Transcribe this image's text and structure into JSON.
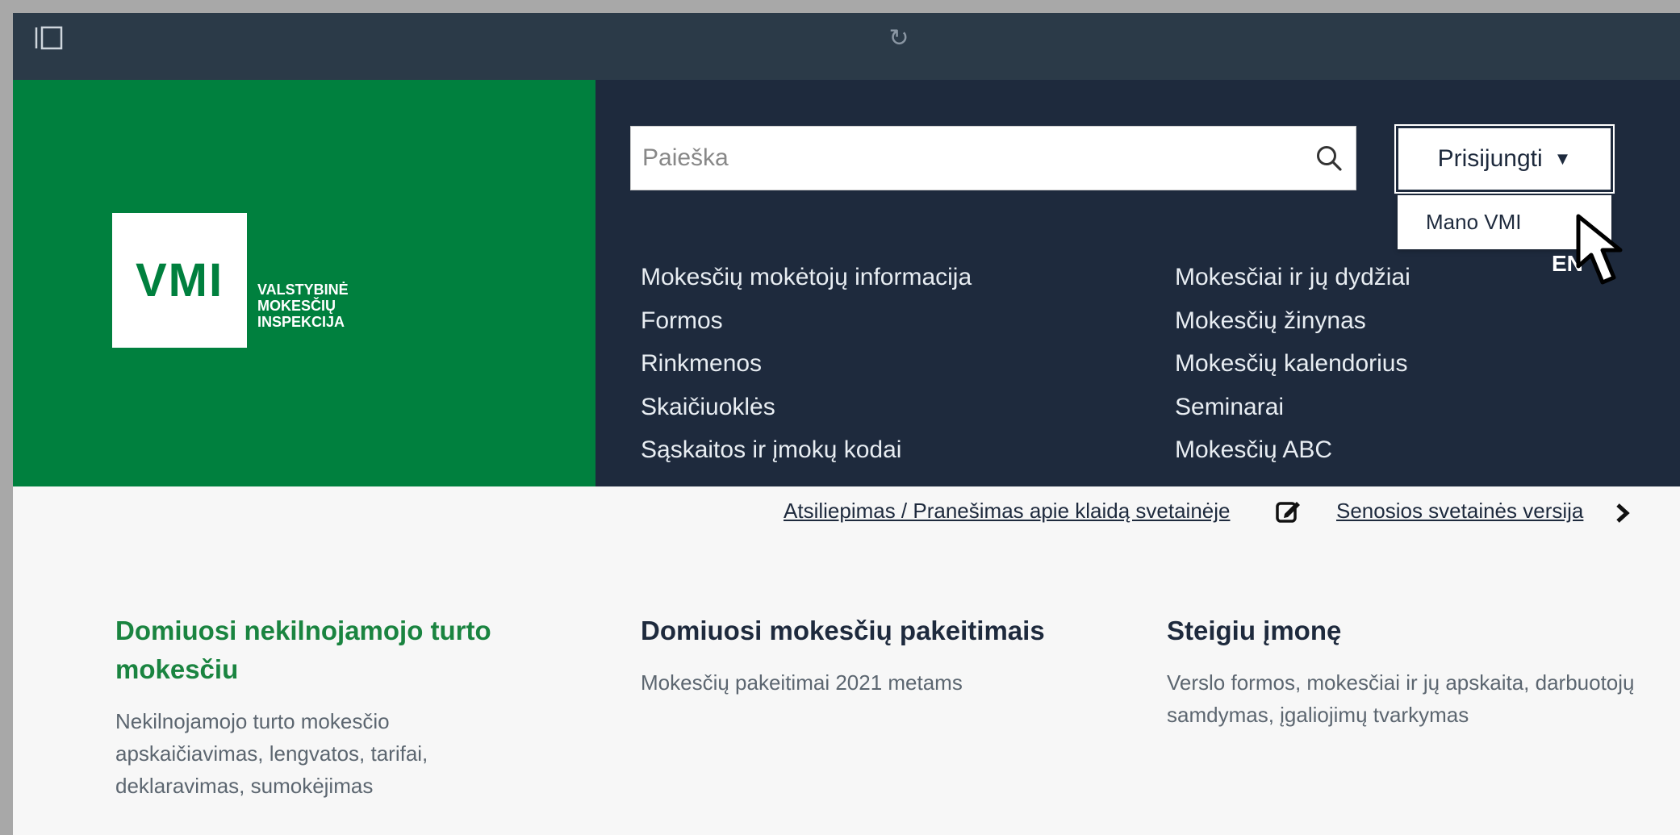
{
  "browser": {
    "sidebar_icon": "sidebar-toggle-icon",
    "reload_icon": "reload-icon",
    "reload_glyph": "↻"
  },
  "header": {
    "logo_mark": "VMI",
    "logo_lines": [
      "VALSTYBINĖ",
      "MOKESČIŲ",
      "INSPEKCIJA"
    ],
    "search_placeholder": "Paieška",
    "login_label": "Prisijungti",
    "login_caret": "▼",
    "dropdown_item": "Mano VMI",
    "lang": "EN",
    "nav_left": [
      "Mokesčių mokėtojų informacija",
      "Formos",
      "Rinkmenos",
      "Skaičiuoklės",
      "Sąskaitos ir įmokų kodai"
    ],
    "nav_right": [
      "Mokesčiai ir jų dydžiai",
      "Mokesčių žinynas",
      "Mokesčių kalendorius",
      "Seminarai",
      "Mokesčių ABC"
    ]
  },
  "links": {
    "feedback": "Atsiliepimas / Pranešimas apie klaidą svetainėje",
    "old_site": "Senosios svetainės versija"
  },
  "cards": [
    {
      "title": "Domiuosi nekilnojamojo turto mokesčiu",
      "text": "Nekilnojamojo turto mokesčio apskaičiavimas, lengvatos, tarifai, deklaravimas, sumokėjimas"
    },
    {
      "title": "Domiuosi mokesčių pakeitimais",
      "text": "Mokesčių pakeitimai 2021 metams"
    },
    {
      "title": "Steigiu įmonę",
      "text": "Verslo formos, mokesčiai ir jų apskaita, darbuotojų samdymas, įgaliojimų tvarkymas"
    }
  ],
  "colors": {
    "brand_green": "#00803e",
    "header_navy": "#1e2a3d",
    "browser_bar": "#2b3a48"
  }
}
